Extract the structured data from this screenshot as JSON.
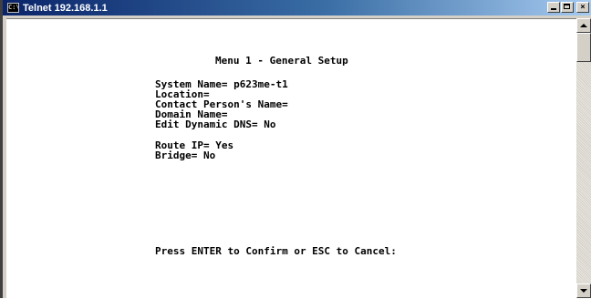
{
  "window": {
    "title": "Telnet 192.168.1.1",
    "icon": "console-icon",
    "controls": {
      "minimize": "minimize-icon",
      "maximize": "maximize-icon",
      "close": "×"
    }
  },
  "terminal": {
    "heading": "Menu 1 - General Setup",
    "fields": {
      "system_name": "System Name= p623me-t1",
      "location": "Location=",
      "contact": "Contact Person's Name=",
      "domain": "Domain Name=",
      "dyndns": "Edit Dynamic DNS= No",
      "route_ip": "Route IP= Yes",
      "bridge": "Bridge= No"
    },
    "prompt": "Press ENTER to Confirm or ESC to Cancel:"
  },
  "colors": {
    "titlebar_start": "#0a246a",
    "titlebar_end": "#a6caf0",
    "terminal_bg": "#ffffff",
    "terminal_text": "#000000"
  }
}
